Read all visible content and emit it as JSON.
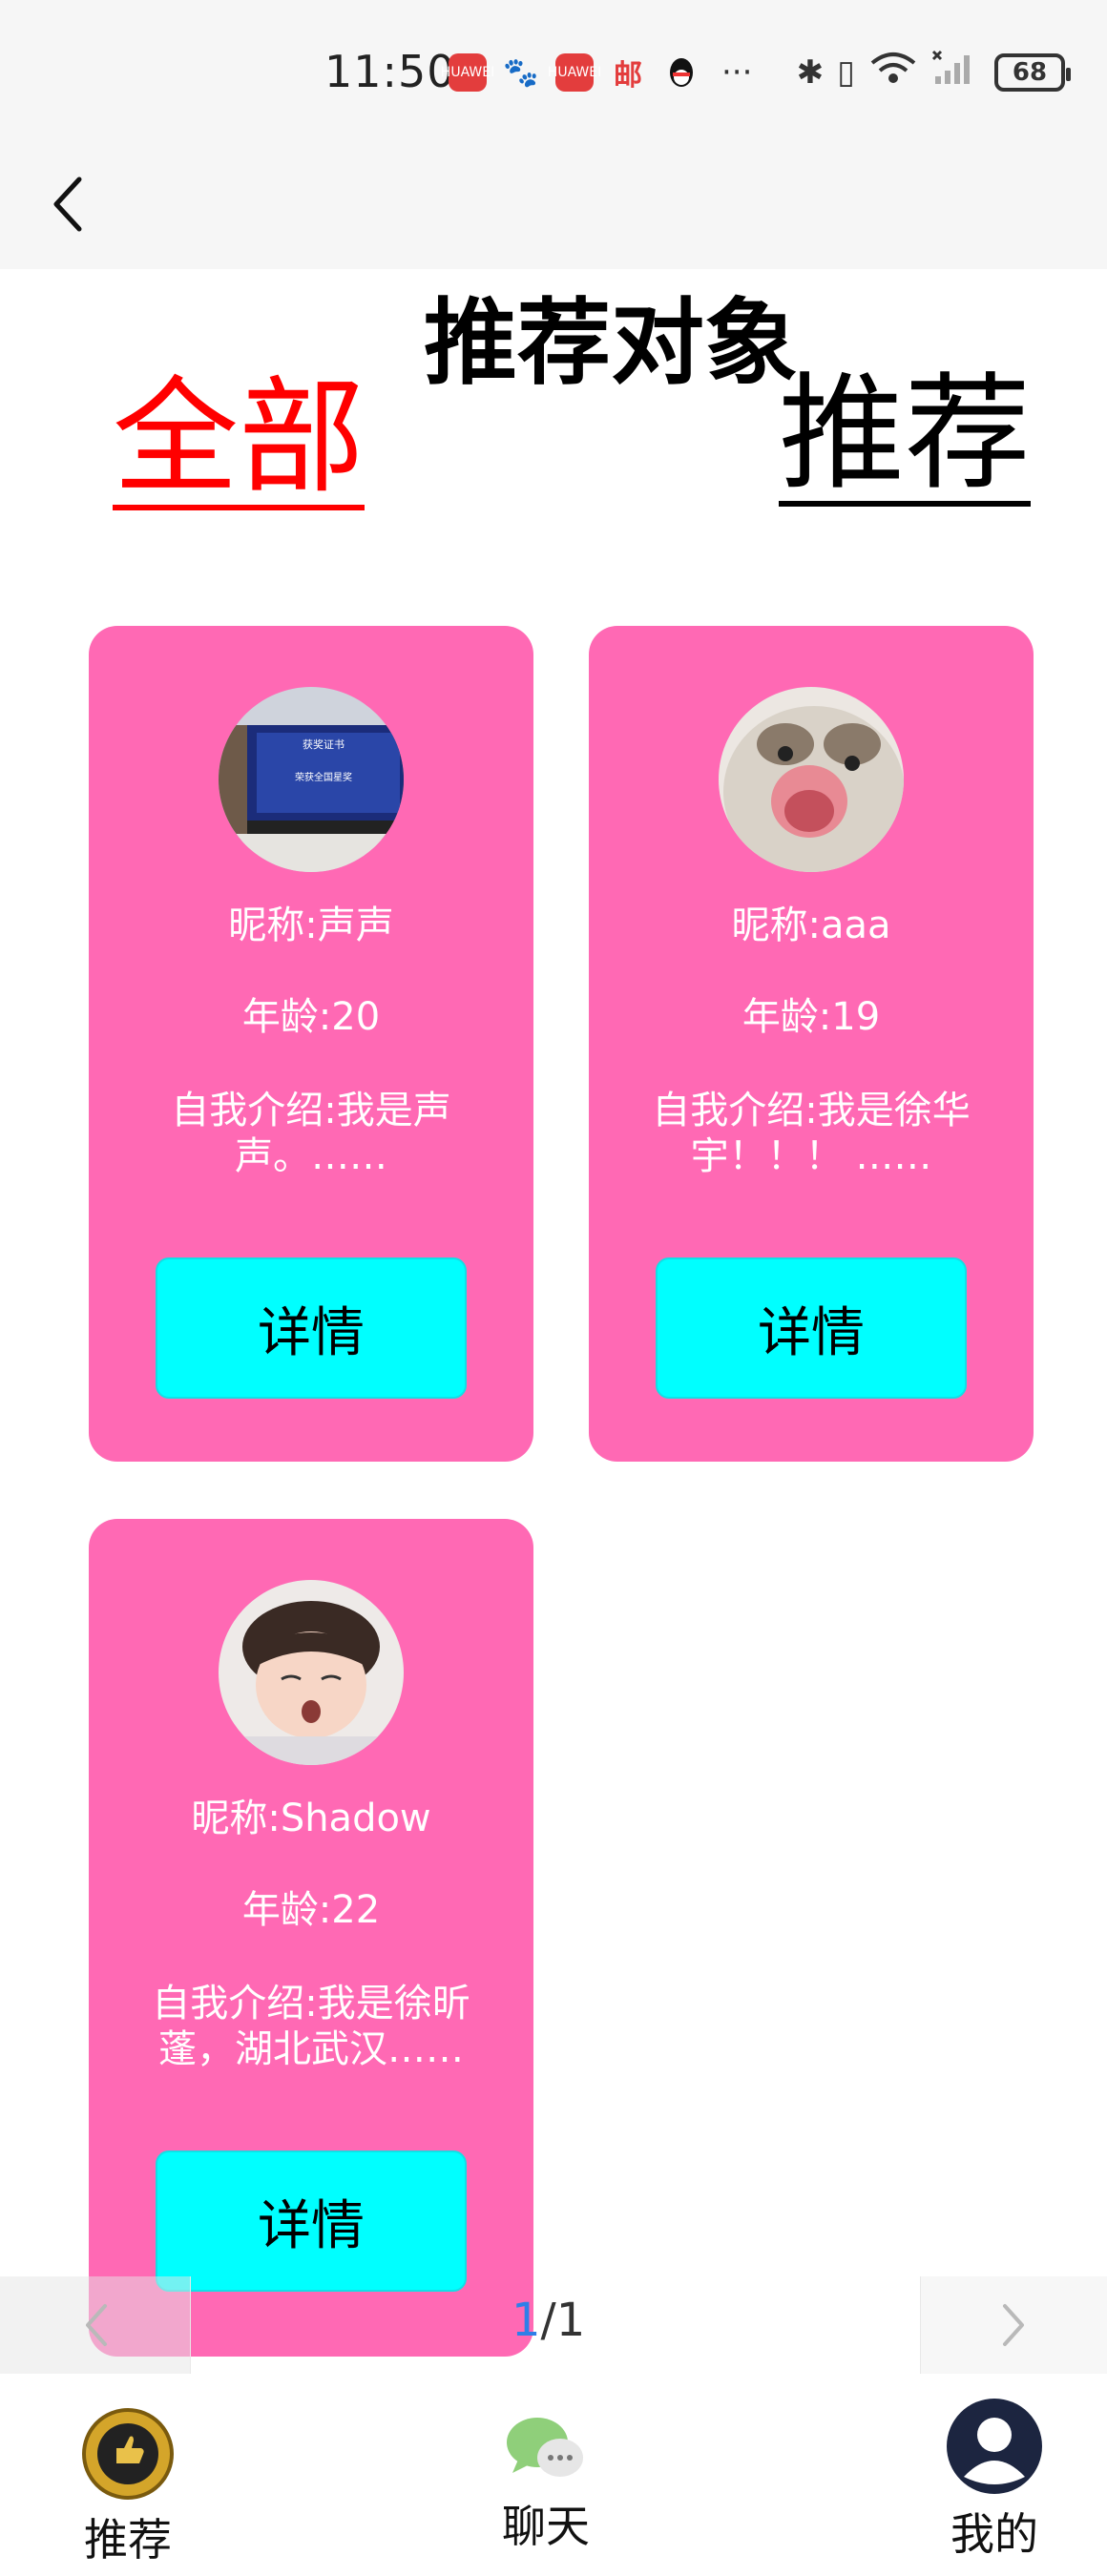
{
  "status_bar": {
    "time": "11:50",
    "battery": "68",
    "app_icon_labels": [
      "HUAWEI",
      "HUAWEI",
      "邮"
    ],
    "more": "···"
  },
  "header": {
    "title": "推荐对象"
  },
  "tabs": {
    "all": "全部",
    "recommend": "推荐"
  },
  "cards": [
    {
      "nickname": "昵称:声声",
      "age": "年龄:20",
      "intro": "自我介绍:我是声声。……",
      "detail": "详情"
    },
    {
      "nickname": "昵称:aaa",
      "age": "年龄:19",
      "intro": "自我介绍:我是徐华宇！！！ ……",
      "detail": "详情"
    },
    {
      "nickname": "昵称:Shadow",
      "age": "年龄:22",
      "intro": "自我介绍:我是徐昕蓬，湖北武汉……",
      "detail": "详情"
    }
  ],
  "avatar1_text": {
    "line1": "获奖证书",
    "line2": "荣获全国星奖"
  },
  "pagination": {
    "current": "1",
    "total": "/1"
  },
  "tabbar": {
    "home": "推荐",
    "chat": "聊天",
    "mine": "我的"
  },
  "colors": {
    "card": "#ff69b4",
    "detail_button": "#00ffff",
    "active_tab": "#ff0000",
    "page_current": "#2f7fe8"
  },
  "icons": {
    "back": "chevron-left-icon",
    "prev": "chevron-left-icon",
    "next": "chevron-right-icon",
    "home": "recommend-badge-icon",
    "chat": "chat-bubbles-icon",
    "mine": "user-icon"
  }
}
